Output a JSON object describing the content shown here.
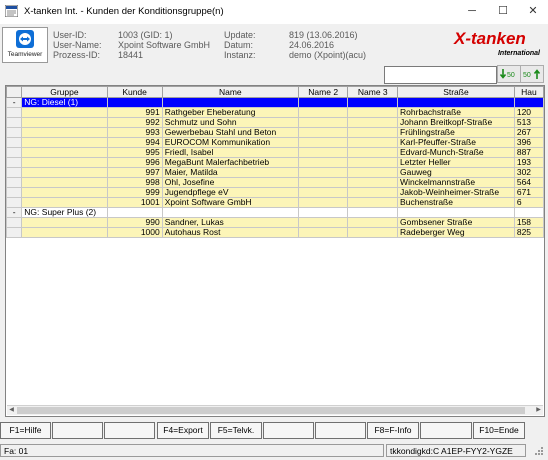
{
  "window": {
    "title": "X-tanken Int. - Kunden der Konditionsgruppe(n)",
    "minimize": "─",
    "maximize": "☐",
    "close": "✕"
  },
  "teamviewer": {
    "label": "Teamviewer"
  },
  "info": {
    "user_id_label": "User-ID:",
    "user_id": "1003 (GID: 1)",
    "user_name_label": "User-Name:",
    "user_name": "Xpoint Software GmbH",
    "prozess_label": "Prozess-ID:",
    "prozess": "18441",
    "update_label": "Update:",
    "update": "819 (13.06.2016)",
    "datum_label": "Datum:",
    "datum": "24.06.2016",
    "instanz_label": "Instanz:",
    "instanz": "demo (Xpoint)(acu)"
  },
  "logo": {
    "brand": "X-tanken",
    "sub": "International",
    "brand_color": "#d40000"
  },
  "search": {
    "value": "",
    "btn1": "↓50",
    "btn2": "50↑"
  },
  "grid": {
    "columns": [
      "Gruppe",
      "Kunde",
      "Name",
      "Name 2",
      "Name 3",
      "Straße",
      "Hau"
    ],
    "rows": [
      {
        "kind": "group",
        "selected": true,
        "marker": "-",
        "gruppe": "NG: Diesel (1)"
      },
      {
        "kind": "data",
        "kunde": "991",
        "name": "Rathgeber Eheberatung",
        "strasse": "Rohrbachstraße",
        "hau": "120"
      },
      {
        "kind": "data",
        "kunde": "992",
        "name": "Schmutz und Sohn",
        "strasse": "Johann Breitkopf-Straße",
        "hau": "513"
      },
      {
        "kind": "data",
        "kunde": "993",
        "name": "Gewerbebau Stahl und Beton",
        "strasse": "Frühlingstraße",
        "hau": "267"
      },
      {
        "kind": "data",
        "kunde": "994",
        "name": "EUROCOM Kommunikation",
        "strasse": "Karl-Pfeuffer-Straße",
        "hau": "396"
      },
      {
        "kind": "data",
        "kunde": "995",
        "name": "Friedl, Isabel",
        "strasse": "Edvard-Munch-Straße",
        "hau": "887"
      },
      {
        "kind": "data",
        "kunde": "996",
        "name": "MegaBunt Malerfachbetrieb",
        "strasse": "Letzter Heller",
        "hau": "193"
      },
      {
        "kind": "data",
        "kunde": "997",
        "name": "Maier, Matilda",
        "strasse": "Gauweg",
        "hau": "302"
      },
      {
        "kind": "data",
        "kunde": "998",
        "name": "Ohl, Josefine",
        "strasse": "Winckelmannstraße",
        "hau": "564"
      },
      {
        "kind": "data",
        "kunde": "999",
        "name": "Jugendpflege eV",
        "strasse": "Jakob-Weinheimer-Straße",
        "hau": "671"
      },
      {
        "kind": "data",
        "kunde": "1001",
        "name": "Xpoint Software GmbH",
        "strasse": "Buchenstraße",
        "hau": "6"
      },
      {
        "kind": "group",
        "selected": false,
        "marker": "-",
        "gruppe": "NG: Super Plus (2)"
      },
      {
        "kind": "data",
        "kunde": "990",
        "name": "Sandner, Lukas",
        "strasse": "Gombsener Straße",
        "hau": "158"
      },
      {
        "kind": "data",
        "kunde": "1000",
        "name": "Autohaus Rost",
        "strasse": "Radeberger Weg",
        "hau": "825"
      }
    ]
  },
  "fkeys": [
    "F1=Hilfe",
    "",
    "",
    "F4=Export",
    "F5=Telvk.",
    "",
    "",
    "F8=F-Info",
    "",
    "F10=Ende"
  ],
  "status": {
    "left": "Fa: 01",
    "right": "tkkondigkd:C A1EP-FYY2-YGZE"
  }
}
